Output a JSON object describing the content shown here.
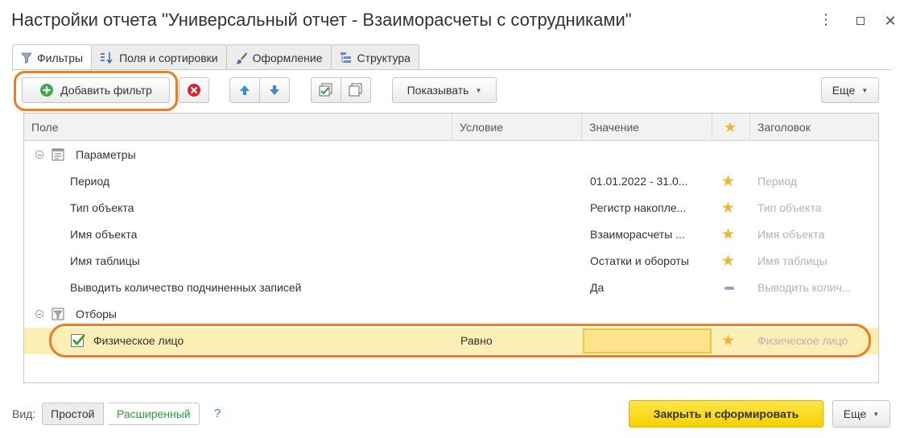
{
  "window": {
    "title": "Настройки отчета \"Универсальный отчет - Взаиморасчеты с сотрудниками\"",
    "more_glyph": "⋮",
    "close_glyph": "✕"
  },
  "tabs": [
    {
      "label": "Фильтры",
      "icon": "filter-icon",
      "active": true
    },
    {
      "label": "Поля и сортировки",
      "icon": "fields-sort-icon",
      "active": false
    },
    {
      "label": "Оформление",
      "icon": "brush-icon",
      "active": false
    },
    {
      "label": "Структура",
      "icon": "structure-icon",
      "active": false
    }
  ],
  "toolbar": {
    "add_filter_label": "Добавить фильтр",
    "show_label": "Показывать",
    "more_label": "Еще"
  },
  "grid": {
    "columns": [
      "Поле",
      "Условие",
      "Значение",
      "★",
      "Заголовок"
    ],
    "groups": [
      {
        "label": "Параметры",
        "rows": [
          {
            "field": "Период",
            "condition": "",
            "value": "01.01.2022 - 31.0...",
            "flag": "star",
            "header": "Период"
          },
          {
            "field": "Тип объекта",
            "condition": "",
            "value": "Регистр накопле...",
            "flag": "star",
            "header": "Тип объекта"
          },
          {
            "field": "Имя объекта",
            "condition": "",
            "value": "Взаиморасчеты ...",
            "flag": "star",
            "header": "Имя объекта"
          },
          {
            "field": "Имя таблицы",
            "condition": "",
            "value": "Остатки и обороты",
            "flag": "star",
            "header": "Имя таблицы"
          },
          {
            "field": "Выводить количество подчиненных записей",
            "condition": "",
            "value": "Да",
            "flag": "dash",
            "header": "Выводить колич..."
          }
        ]
      },
      {
        "label": "Отборы",
        "rows": [
          {
            "field": "Физическое лицо",
            "condition": "Равно",
            "value": "",
            "flag": "star",
            "header": "Физическое лицо",
            "checked": true,
            "selected": true
          }
        ]
      }
    ]
  },
  "footer": {
    "view_label": "Вид:",
    "simple_label": "Простой",
    "extended_label": "Расширенный",
    "help_label": "?",
    "close_generate_label": "Закрыть и сформировать",
    "more_label": "Еще"
  },
  "colors": {
    "highlight_ring": "#f07c1d",
    "primary_button": "#f5d100",
    "selected_row": "#fcefb5",
    "star": "#f2b533"
  }
}
